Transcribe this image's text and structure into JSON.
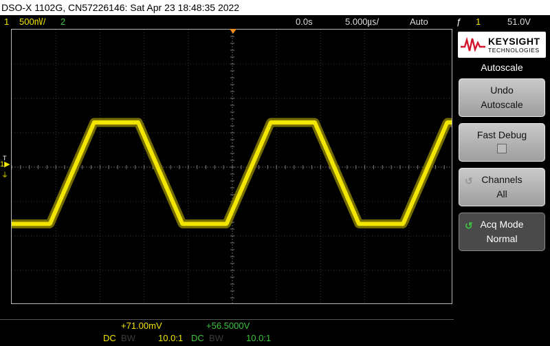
{
  "title": "DSO-X 1102G, CN57226146: Sat Apr 23 18:48:35 2022",
  "status": {
    "ch1_num": "1",
    "ch1_scale": "500㎵/",
    "ch2_num": "2",
    "time_delay": "0.0s",
    "time_scale": "5.000㎲/",
    "trigger_mode": "Auto",
    "trigger_icon": "ƒ",
    "trigger_source": "1",
    "trigger_level": "51.0V"
  },
  "markers": {
    "trigger_time": "T",
    "channel_label": "1▶",
    "ground": "⏚"
  },
  "panel": {
    "logo_brand": "KEYSIGHT",
    "logo_sub": "TECHNOLOGIES",
    "menu_title": "Autoscale",
    "softkeys": [
      {
        "line1": "Undo",
        "line2": "Autoscale"
      },
      {
        "line1": "Fast Debug",
        "line2": ""
      },
      {
        "line1": "Channels",
        "line2": "All"
      },
      {
        "line1": "Acq Mode",
        "line2": "Normal"
      }
    ],
    "rot_icon": "↺"
  },
  "bottom": {
    "ch1_offset": "+71.00mV",
    "ch2_offset": "+56.5000V",
    "ch1_coupling": "DC",
    "ch1_bw": "BW",
    "ch1_probe": "10.0:1",
    "ch2_coupling": "DC",
    "ch2_bw": "BW",
    "ch2_probe": "10.0:1"
  },
  "colors": {
    "channel1": "#f2e600",
    "channel2": "#3ec43e",
    "trigger_marker": "#f08c1e"
  },
  "waveform": {
    "shape": "trapezoid",
    "period_divisions": 4.0,
    "high_level_divisions": 1.3,
    "low_level_divisions": -1.65
  }
}
